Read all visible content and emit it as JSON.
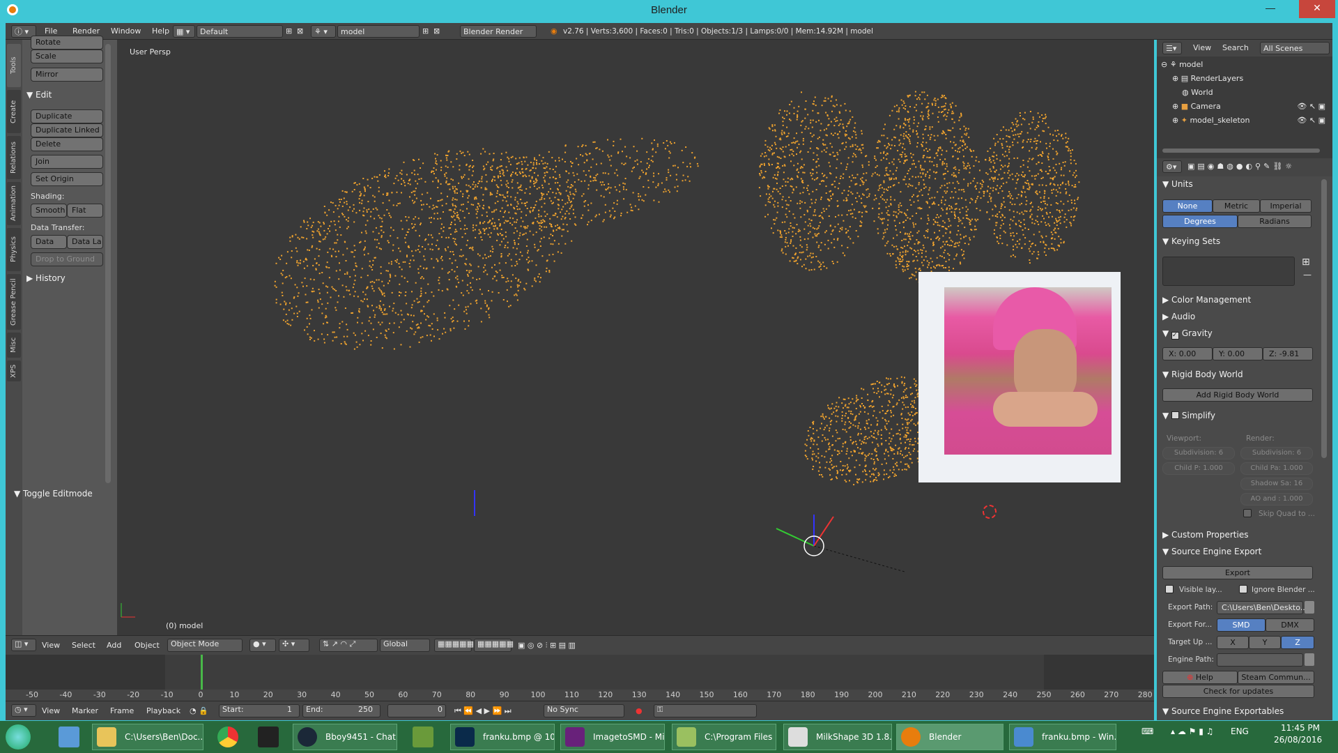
{
  "window": {
    "title": "Blender",
    "min": "—",
    "max": "☐",
    "close": "✕"
  },
  "infobar": {
    "menus": [
      "File",
      "Render",
      "Window",
      "Help"
    ],
    "screen": "Default",
    "scene": "model",
    "engine": "Blender Render",
    "stats": "v2.76 | Verts:3,600 | Faces:0 | Tris:0 | Objects:1/3 | Lamps:0/0 | Mem:14.92M | model"
  },
  "toolshelf": {
    "tabs": [
      "Tools",
      "Create",
      "Relations",
      "Animation",
      "Physics",
      "Grease Pencil",
      "Misc",
      "XPS"
    ],
    "buttons": {
      "rotate": "Rotate",
      "scale": "Scale",
      "mirror": "Mirror",
      "duplicate": "Duplicate",
      "duplicate_linked": "Duplicate Linked",
      "delete": "Delete",
      "join": "Join",
      "set_origin": "Set Origin",
      "smooth": "Smooth",
      "flat": "Flat",
      "data": "Data",
      "data_la": "Data La",
      "drop_to_ground": "Drop to Ground"
    },
    "edit_header": "Edit",
    "shading_label": "Shading:",
    "data_transfer_label": "Data Transfer:",
    "history_header": "History",
    "toggle_editmode": "Toggle Editmode"
  },
  "viewport": {
    "view_label": "User Persp",
    "object_label": "(0) model"
  },
  "view3d_header": {
    "menus": [
      "View",
      "Select",
      "Add",
      "Object"
    ],
    "mode": "Object Mode",
    "orientation": "Global"
  },
  "timeline": {
    "ticks": [
      -50,
      -40,
      -30,
      -20,
      -10,
      0,
      10,
      20,
      30,
      40,
      50,
      60,
      70,
      80,
      90,
      100,
      110,
      120,
      130,
      140,
      150,
      160,
      170,
      180,
      190,
      200,
      210,
      220,
      230,
      240,
      250,
      260,
      270,
      280
    ],
    "menus": [
      "View",
      "Marker",
      "Frame",
      "Playback"
    ],
    "start_label": "Start:",
    "start": "1",
    "end_label": "End:",
    "end": "250",
    "current": "0",
    "sync": "No Sync"
  },
  "outliner": {
    "menus": [
      "View",
      "Search"
    ],
    "scope": "All Scenes",
    "items": [
      "model",
      "RenderLayers",
      "World",
      "Camera",
      "model_skeleton"
    ]
  },
  "properties": {
    "units": {
      "header": "Units",
      "none": "None",
      "metric": "Metric",
      "imperial": "Imperial",
      "degrees": "Degrees",
      "radians": "Radians"
    },
    "keying_sets": "Keying Sets",
    "color_management": "Color Management",
    "audio": "Audio",
    "gravity": {
      "header": "Gravity",
      "x": "X:  0.00",
      "y": "Y:  0.00",
      "z": "Z:  -9.81"
    },
    "rigid_body_world": {
      "header": "Rigid Body World",
      "button": "Add Rigid Body World"
    },
    "simplify": {
      "header": "Simplify",
      "viewport_label": "Viewport:",
      "render_label": "Render:",
      "subdivision": "Subdivision:  6",
      "subdivision_r": "Subdivision:  6",
      "child_p": "Child P:  1.000",
      "child_pa": "Child Pa: 1.000",
      "shadow": "Shadow Sa: 16",
      "ao": "AO and : 1.000",
      "skip_quad": "Skip Quad to ..."
    },
    "custom_properties": "Custom Properties",
    "source_engine_export": {
      "header": "Source Engine Export",
      "export": "Export",
      "visible_layers": "Visible lay...",
      "ignore_blender": "Ignore Blender ...",
      "export_path_label": "Export Path:",
      "export_path": "C:\\Users\\Ben\\Deskto...",
      "export_format_label": "Export For...",
      "smd": "SMD",
      "dmx": "DMX",
      "target_up_label": "Target Up ...",
      "x": "X",
      "y": "Y",
      "z": "Z",
      "engine_path_label": "Engine Path:",
      "help": "Help",
      "steam": "Steam Commun...",
      "check_updates": "Check for updates"
    },
    "exportables": "Source Engine Exportables"
  },
  "taskbar": {
    "items": [
      "C:\\Users\\Ben\\Doc...",
      "Bboy9451 - Chat",
      "franku.bmp @ 10...",
      "ImagetoSMD - Mi...",
      "C:\\Program Files ...",
      "MilkShape 3D 1.8....",
      "Blender",
      "franku.bmp - Win..."
    ],
    "lang": "ENG",
    "time": "11:45 PM",
    "date": "26/08/2016"
  },
  "colors": {
    "accent": "#5680c2",
    "points": "#f0a32e",
    "chrome": "#3fc7d6",
    "taskbar": "#27693c"
  }
}
